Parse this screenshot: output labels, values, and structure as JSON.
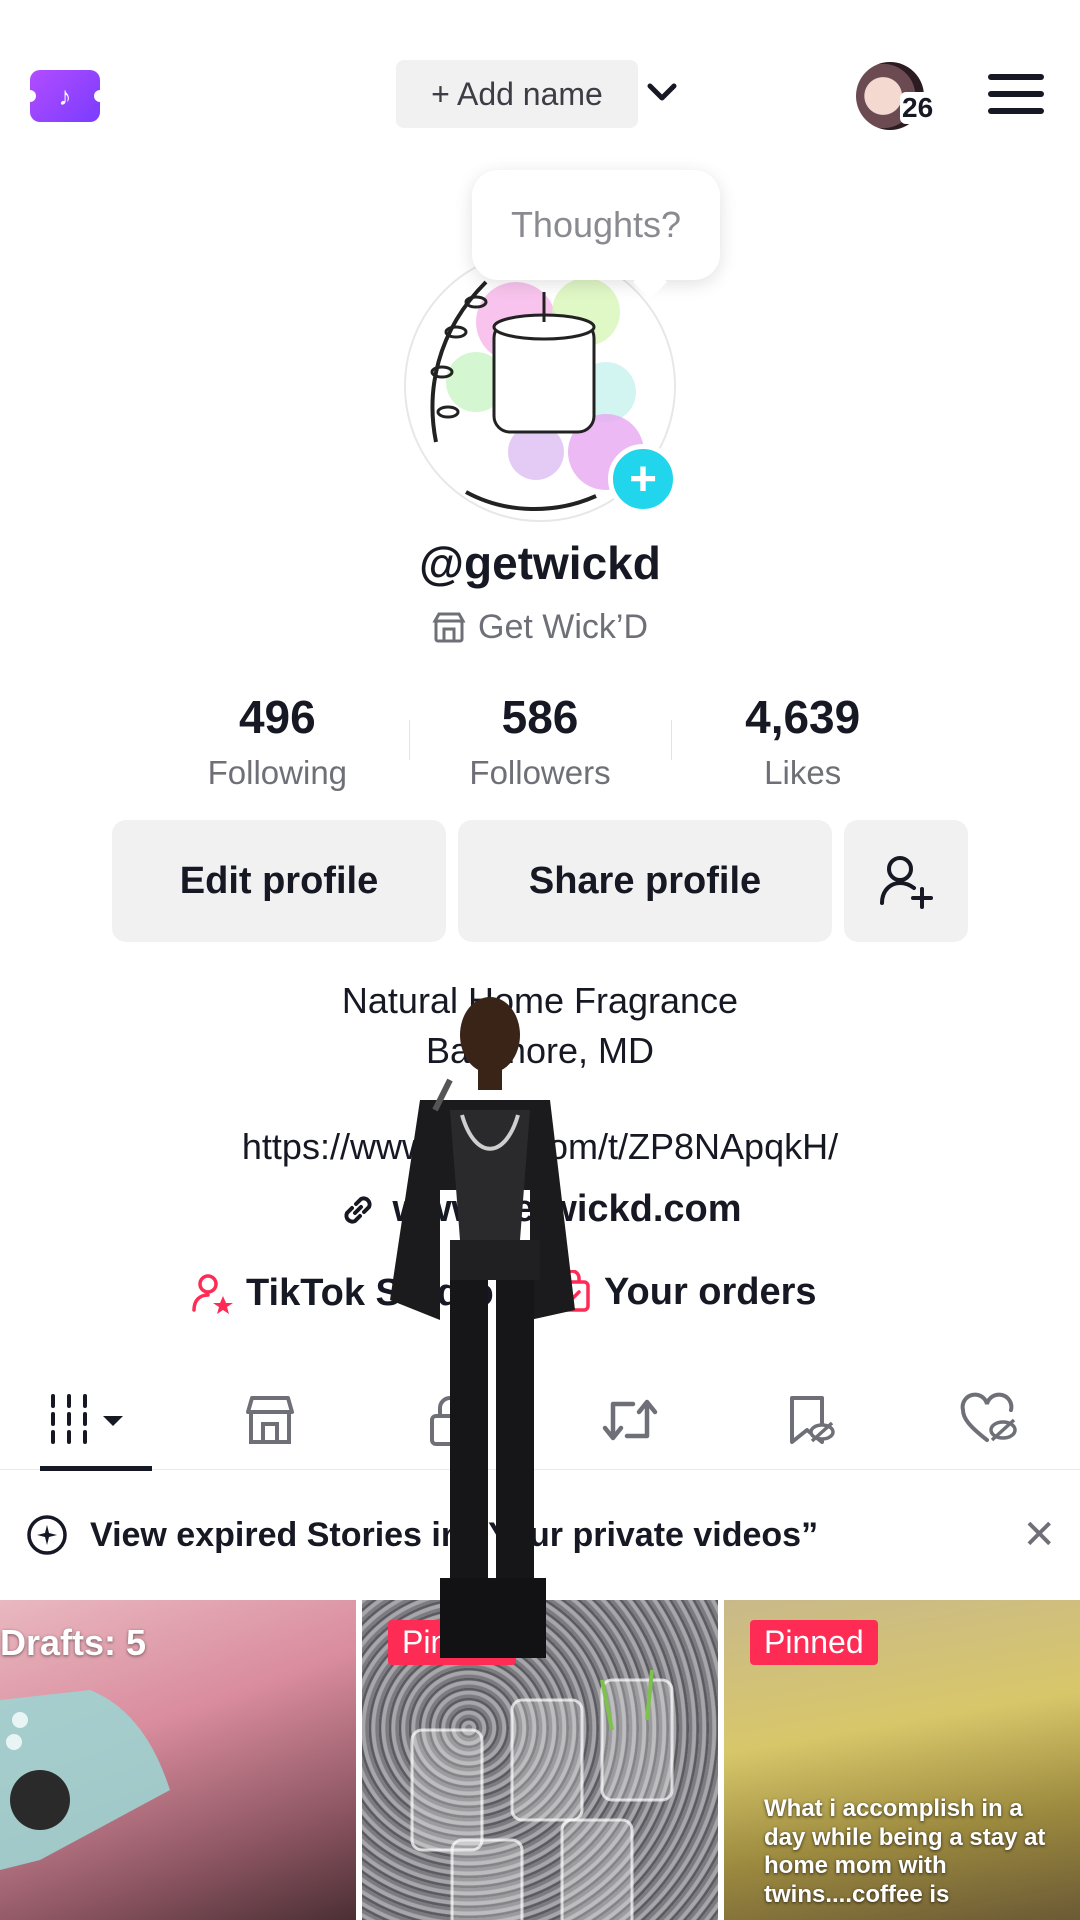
{
  "header": {
    "add_name_label": "+ Add name",
    "notification_count": "26"
  },
  "tooltip": {
    "text": "Thoughts?"
  },
  "profile": {
    "username": "@getwickd",
    "business_name": "Get Wick’D"
  },
  "stats": [
    {
      "value": "496",
      "label": "Following"
    },
    {
      "value": "586",
      "label": "Followers"
    },
    {
      "value": "4,639",
      "label": "Likes"
    }
  ],
  "buttons": {
    "edit": "Edit profile",
    "share": "Share profile"
  },
  "bio": {
    "line1": "Natural Home Fragrance",
    "line2": "Baltimore, MD",
    "url": "https://www.tiktok.com/t/ZP8NApqkH/",
    "website": "www.getwickd.com"
  },
  "shortcuts": {
    "studio": "TikTok Studio",
    "orders": "Your orders"
  },
  "notice": {
    "text": "View expired Stories in “Your private videos”"
  },
  "grid": {
    "drafts_label": "Drafts: 5",
    "pinned_label": "Pinned",
    "caption": "What i accomplish in a day while being a stay at home mom with twins....coffee is"
  },
  "colors": {
    "accent_pink": "#fe2c55",
    "accent_cyan": "#20d5ec",
    "ticket_purple": "#9b45ff"
  }
}
